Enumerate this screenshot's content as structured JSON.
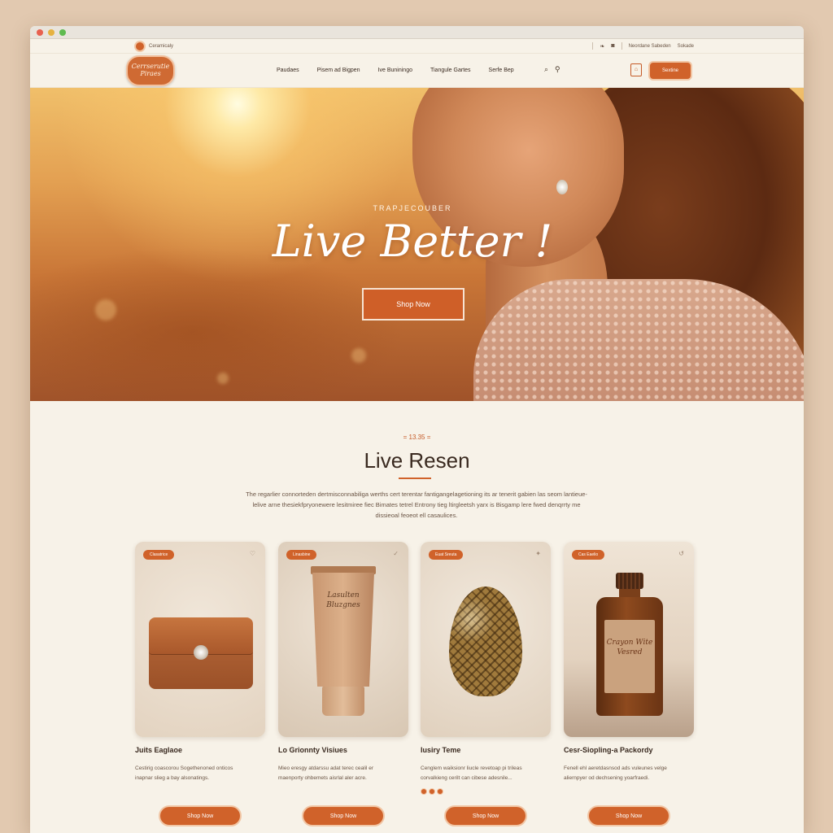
{
  "utility_bar": {
    "store_name": "Ceramicaly",
    "links": [
      "Neordane Sabeden",
      "Sokade"
    ]
  },
  "brand": {
    "line1": "Cerrserutie",
    "line2": "Piraes"
  },
  "nav": {
    "links": [
      "Paudaes",
      "Pisem ad Bigpen",
      "Ive Buniningo",
      "Tiangule Gartes",
      "Serfe Bep"
    ],
    "cta_label": "Sextine"
  },
  "hero": {
    "kicker": "TRAPJECOUBER",
    "headline": "Live Better !",
    "button_label": "Shop Now"
  },
  "section": {
    "kicker": "= 13.35 =",
    "title": "Live Resen",
    "body": "The regarlier connorteden dertmisconnabiliga werths cert terentar fantigangelagetioning its ar tenerit gabien las seom lantieue-lelive arne thesiekfpryonewere lesitmiree fiec Bimates tetrel Entrony tieg ltirgleetsh yarx is Bisgamp lere fwed denqrrty me dissieoal feoeot ell casaulices."
  },
  "products": [
    {
      "badge": "Clasatrice",
      "name": "Juits Eaglaoe",
      "desc": "Cestirig coascorou Sogethenoned onticos inapnar slieg a bay alsonatings.",
      "button": "Shop Now"
    },
    {
      "badge": "Linasbine",
      "name": "Lo Grionnty Visiues",
      "desc": "Mieo eresgy atdarssu adat terec cealil er maenporty ohbemets aisrlal aler acre.",
      "button": "Shop Now"
    },
    {
      "badge": "Euat Sreuta",
      "name": "Iusiry Teme",
      "desc": "Cenglem waiksionr liucle revetoap pi trileas corvalkieng cerilt can cibese adesnile...",
      "button": "Shop Now"
    },
    {
      "badge": "Cas Eaelio",
      "name": "Cesr-Siopling-a Packordy",
      "desc": "Fenell ehl aeretdasnsod ads vuleunes velge aliernpyer od dechsening yoarfraedi.",
      "button": "Shop Now"
    }
  ],
  "product_visuals": {
    "tube_label": "Lasulten Bluzgnes",
    "bottle_label": "Crayon Wite Vesred"
  },
  "colors": {
    "accent": "#d0622a",
    "background": "#f7f2e8",
    "text": "#3a2a20"
  }
}
